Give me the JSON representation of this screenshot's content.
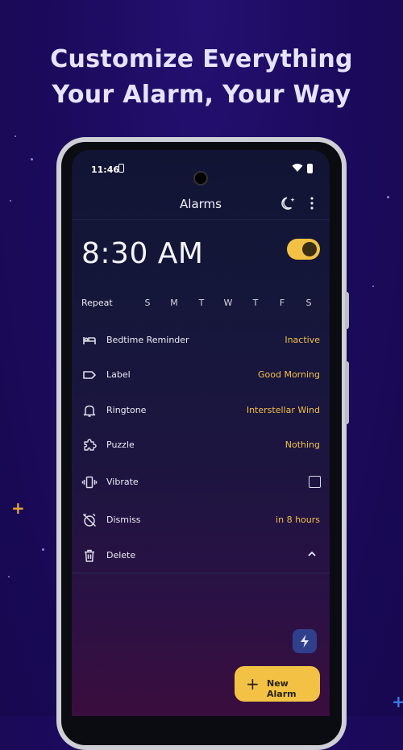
{
  "headline": {
    "line1": "Customize Everything",
    "line2": "Your Alarm, Your Way"
  },
  "status_bar": {
    "time": "11:46"
  },
  "app_bar": {
    "title": "Alarms",
    "icons": [
      "moon-stars-icon",
      "more-vert-icon"
    ]
  },
  "alarm": {
    "time": "8:30 AM",
    "enabled": true,
    "repeat_label": "Repeat",
    "days": [
      "S",
      "M",
      "T",
      "W",
      "T",
      "F",
      "S"
    ],
    "settings": [
      {
        "icon": "bed-icon",
        "label": "Bedtime Reminder",
        "value": "Inactive"
      },
      {
        "icon": "label-icon",
        "label": "Label",
        "value": "Good Morning"
      },
      {
        "icon": "bell-icon",
        "label": "Ringtone",
        "value": "Interstellar Wind"
      },
      {
        "icon": "puzzle-icon",
        "label": "Puzzle",
        "value": "Nothing"
      },
      {
        "icon": "vibrate-icon",
        "label": "Vibrate",
        "checked": false
      },
      {
        "icon": "alarm-off-icon",
        "label": "Dismiss",
        "value": "in 8 hours"
      },
      {
        "icon": "trash-icon",
        "label": "Delete",
        "expanded": true
      }
    ]
  },
  "fab": {
    "new_alarm_label": "New Alarm"
  },
  "colors": {
    "accent": "#f3c245",
    "background": "#1c0b5e",
    "screen_top": "#121434",
    "screen_bottom": "#3a0e3e"
  }
}
